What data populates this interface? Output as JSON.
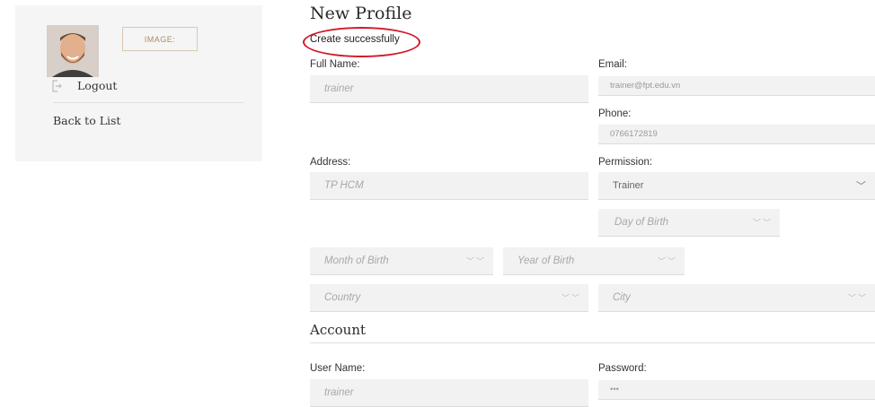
{
  "sidebar": {
    "image_button": "IMAGE:",
    "logout_label": "Logout",
    "back_label": "Back to List"
  },
  "page": {
    "title": "New Profile",
    "success_message": "Create successfully"
  },
  "form": {
    "full_name": {
      "label": "Full Name:",
      "value": "trainer"
    },
    "email": {
      "label": "Email:",
      "value": "trainer@fpt.edu.vn"
    },
    "phone": {
      "label": "Phone:",
      "value": "0766172819"
    },
    "address": {
      "label": "Address:",
      "value": "TP HCM"
    },
    "permission": {
      "label": "Permission:",
      "value": "Trainer"
    },
    "day_of_birth": {
      "placeholder": "Day of Birth"
    },
    "month_of_birth": {
      "placeholder": "Month of Birth"
    },
    "year_of_birth": {
      "placeholder": "Year of Birth"
    },
    "country": {
      "placeholder": "Country"
    },
    "city": {
      "placeholder": "City"
    }
  },
  "account": {
    "section_title": "Account",
    "user_name": {
      "label": "User Name:",
      "value": "trainer"
    },
    "password": {
      "label": "Password:",
      "value": "•••"
    }
  },
  "colors": {
    "highlight_ring": "#d11a2a",
    "field_bg": "#f2f2f2",
    "accent": "#b48a5f"
  }
}
